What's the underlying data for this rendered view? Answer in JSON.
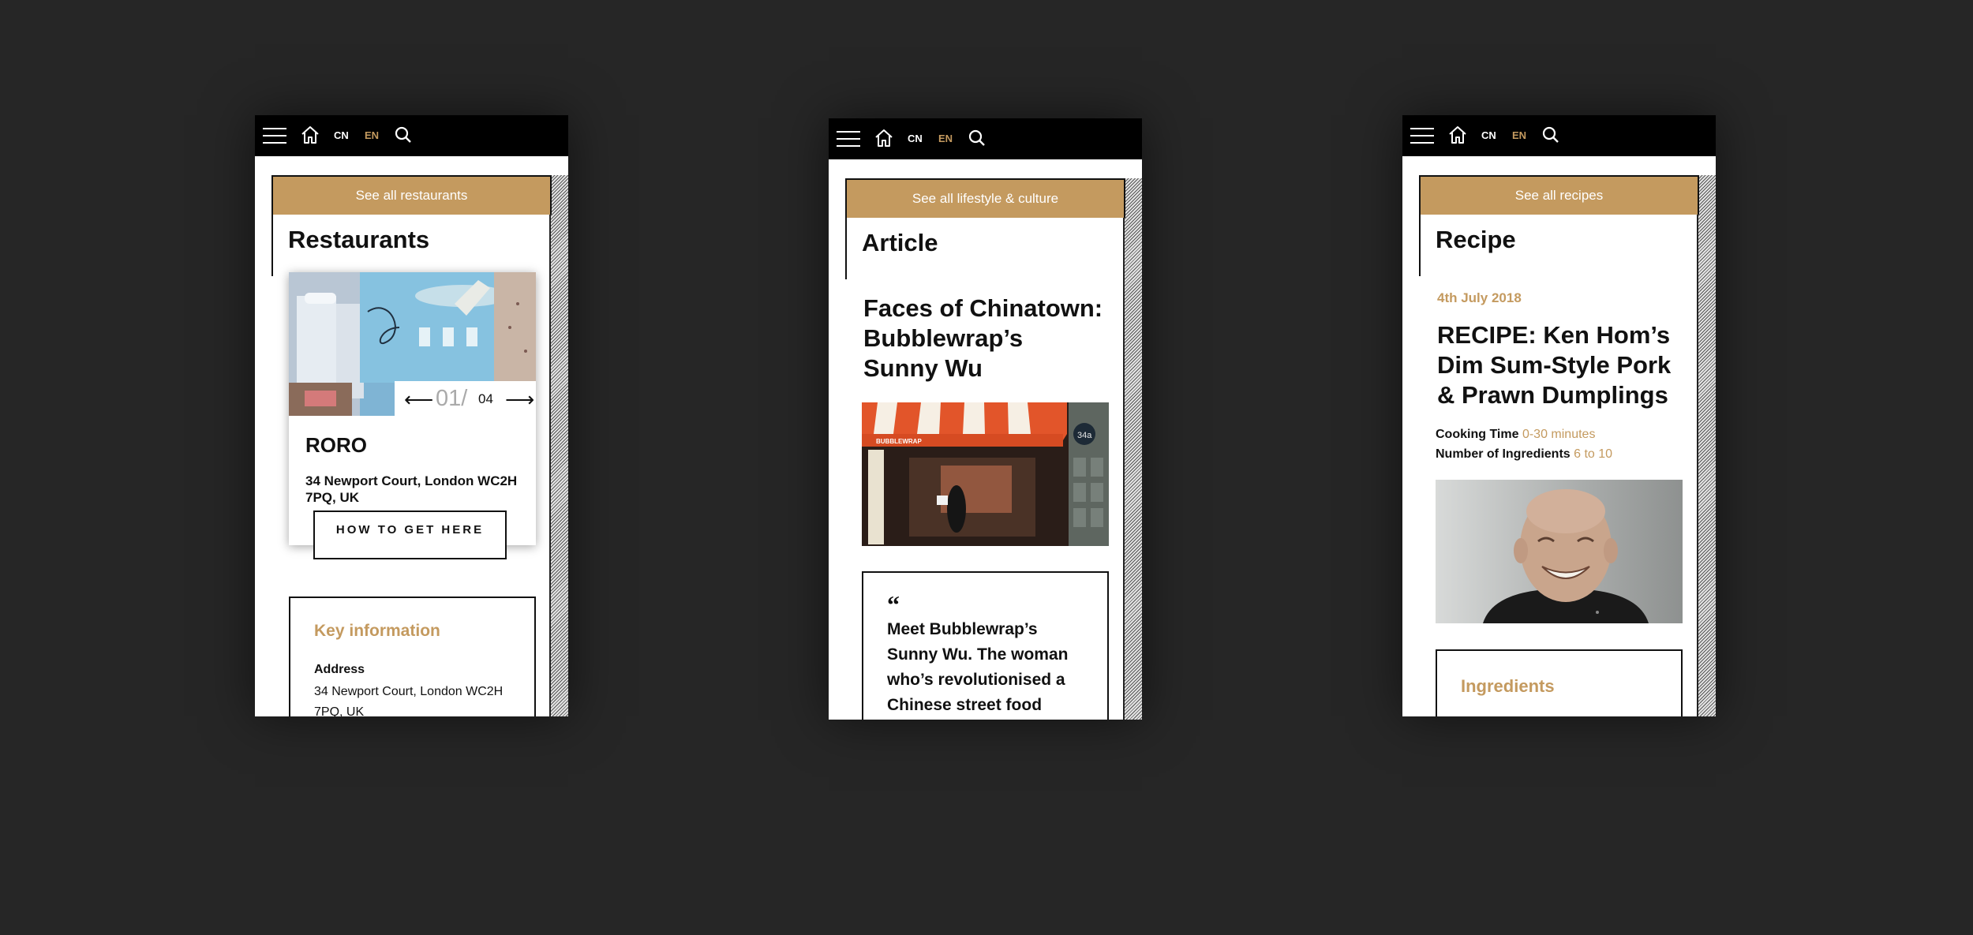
{
  "screens": [
    {
      "nav": {
        "lang_cn": "CN",
        "lang_en": "EN"
      },
      "see_all": "See all restaurants",
      "section_title": "Restaurants",
      "card": {
        "pager_current": "01/",
        "pager_total": "04",
        "name": "RORO",
        "address": "34 Newport Court, London WC2H 7PQ, UK",
        "button": "HOW TO GET HERE"
      },
      "key_info": {
        "title": "Key information",
        "address_label": "Address",
        "address_value": "34 Newport Court, London WC2H 7PQ, UK"
      }
    },
    {
      "nav": {
        "lang_cn": "CN",
        "lang_en": "EN"
      },
      "see_all": "See all lifestyle & culture",
      "section_title": "Article",
      "headline": "Faces of Chinatown: Bubblewrap’s Sunny Wu",
      "image_sign": "BUBBLEWRAP",
      "image_sign_number": "34a",
      "quote_mark": "“",
      "quote": "Meet Bubblewrap’s Sunny Wu. The woman who’s revolutionised a Chinese street food"
    },
    {
      "nav": {
        "lang_cn": "CN",
        "lang_en": "EN"
      },
      "see_all": "See all recipes",
      "section_title": "Recipe",
      "date": "4th July 2018",
      "headline": "RECIPE: Ken Hom’s Dim Sum-Style Pork & Prawn Dumplings",
      "cooking_time_label": "Cooking Time",
      "cooking_time_value": "0-30 minutes",
      "ingredients_count_label": "Number of Ingredients",
      "ingredients_count_value": "6 to 10",
      "ingredients_title": "Ingredients"
    }
  ],
  "colors": {
    "accent_gold": "#c49a5f",
    "background": "#262626",
    "topbar": "#000000"
  },
  "icons": [
    "hamburger-icon",
    "home-icon",
    "search-icon",
    "arrow-left-icon",
    "arrow-right-icon",
    "quote-icon"
  ]
}
